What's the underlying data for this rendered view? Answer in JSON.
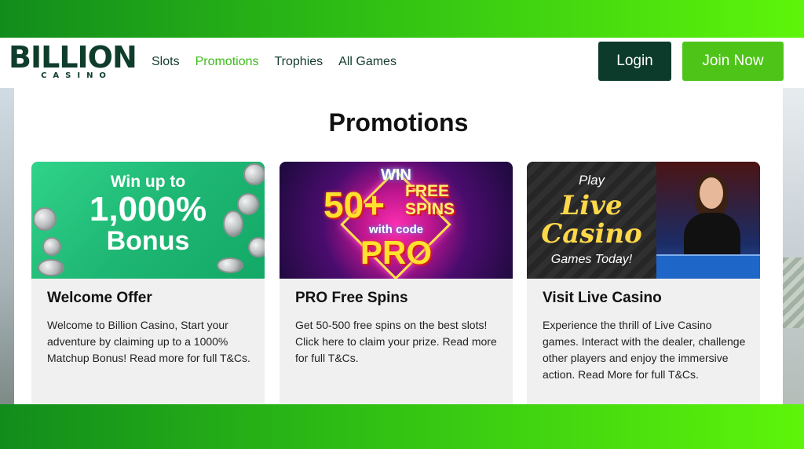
{
  "header": {
    "logo_main": "BILLION",
    "logo_sub": "CASINO",
    "nav": [
      {
        "label": "Slots"
      },
      {
        "label": "Promotions",
        "active": true
      },
      {
        "label": "Trophies"
      },
      {
        "label": "All Games"
      }
    ],
    "login_label": "Login",
    "join_label": "Join Now"
  },
  "page": {
    "title": "Promotions"
  },
  "cards": [
    {
      "title": "Welcome Offer",
      "description": "Welcome to Billion Casino, Start your adventure by claiming up to a 1000% Matchup Bonus! Read more for full T&Cs.",
      "banner": {
        "line1": "Win up to",
        "line2": "1,000%",
        "line3": "Bonus"
      }
    },
    {
      "title": "PRO Free Spins",
      "description": "Get 50-500 free spins on the best slots! Click here to claim your prize. Read more for full T&Cs.",
      "banner": {
        "line1": "WIN",
        "line2": "50+",
        "line3": "FREE SPINS",
        "line4": "with code",
        "line5": "PRO"
      }
    },
    {
      "title": "Visit Live Casino",
      "description": "Experience the thrill of Live Casino games. Interact with the dealer, challenge other players and enjoy the immersive action. Read More for full T&Cs.",
      "banner": {
        "line1": "Play",
        "line2": "Live",
        "line3": "Casino",
        "line4": "Games Today!"
      }
    }
  ],
  "colors": {
    "brand_dark": "#0c3b2c",
    "brand_green": "#4ec418",
    "nav_active": "#3dbb18"
  }
}
